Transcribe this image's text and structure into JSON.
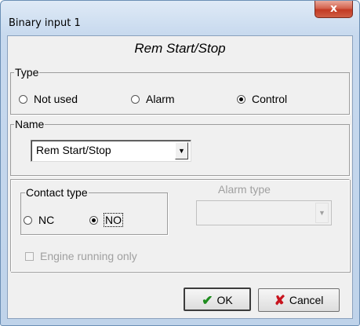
{
  "window": {
    "title": "Binary input 1",
    "close_glyph": "x"
  },
  "heading": "Rem Start/Stop",
  "type_group": {
    "label": "Type",
    "options": [
      {
        "label": "Not used",
        "selected": false
      },
      {
        "label": "Alarm",
        "selected": false
      },
      {
        "label": "Control",
        "selected": true
      }
    ]
  },
  "name_group": {
    "label": "Name",
    "value": "Rem Start/Stop"
  },
  "contact_group": {
    "label": "Contact type",
    "options": [
      {
        "label": "NC",
        "selected": false
      },
      {
        "label": "NO",
        "selected": true
      }
    ]
  },
  "alarm_type": {
    "label": "Alarm type",
    "value": "",
    "enabled": false
  },
  "engine_running_only": {
    "label": "Engine running only",
    "checked": false,
    "enabled": false
  },
  "buttons": {
    "ok": {
      "label": "OK",
      "icon": "check-icon",
      "color": "#1e8c1e"
    },
    "cancel": {
      "label": "Cancel",
      "icon": "cross-icon",
      "color": "#c8141e"
    }
  }
}
